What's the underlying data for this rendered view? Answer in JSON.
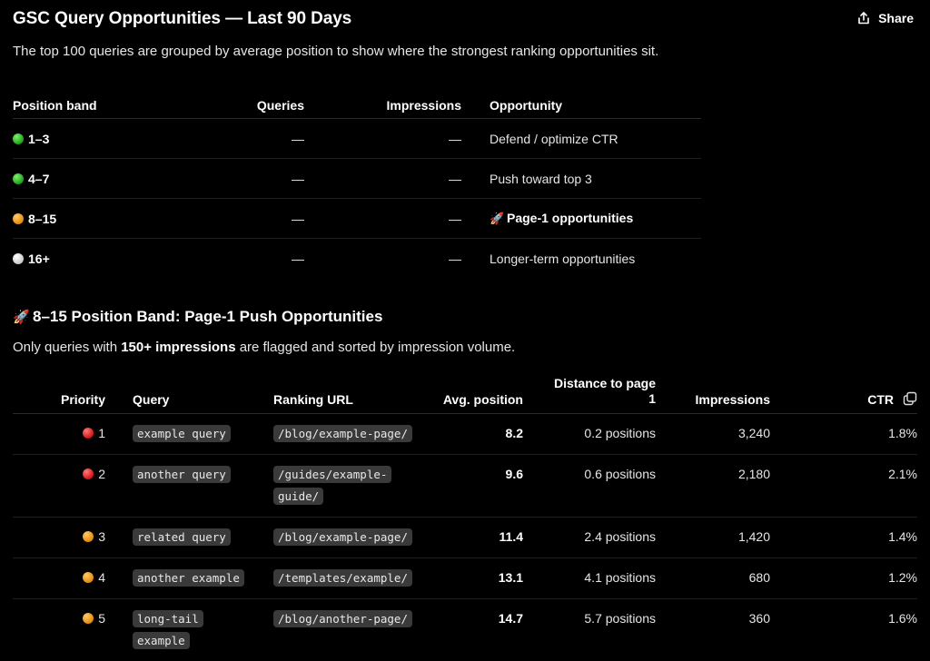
{
  "header": {
    "title": "GSC Query Opportunities — Last 90 Days",
    "share_label": "Share"
  },
  "intro": "The top 100 queries are grouped by average position to show where the strongest ranking opportunities sit.",
  "bands_table": {
    "headers": [
      "Position band",
      "Queries",
      "Impressions",
      "Opportunity"
    ],
    "rows": [
      {
        "band": "1–3",
        "dot": "green",
        "queries": "—",
        "impressions": "—",
        "opportunity": "Defend / optimize CTR",
        "rocket": false
      },
      {
        "band": "4–7",
        "dot": "green",
        "queries": "—",
        "impressions": "—",
        "opportunity": "Push toward top 3",
        "rocket": false
      },
      {
        "band": "8–15",
        "dot": "orange",
        "queries": "—",
        "impressions": "—",
        "opportunity": "Page-1 opportunities",
        "rocket": true
      },
      {
        "band": "16+",
        "dot": "white",
        "queries": "—",
        "impressions": "—",
        "opportunity": "Longer-term opportunities",
        "rocket": false
      }
    ]
  },
  "section": {
    "heading": "8–15 Position Band: Page-1 Push Opportunities",
    "rocket_icon": "🚀",
    "note_before": "Only queries with ",
    "note_bold": "150+ impressions",
    "note_after": " are flagged and sorted by impression volume."
  },
  "opportunities_table": {
    "headers": [
      "Priority",
      "Query",
      "Ranking URL",
      "Avg. position",
      "Distance to page 1",
      "Impressions",
      "CTR"
    ],
    "rows": [
      {
        "priority": "1",
        "dot": "red",
        "query": "example query",
        "url": "/blog/example-page/",
        "avg": "8.2",
        "distance": "0.2 positions",
        "impressions": "3,240",
        "ctr": "1.8%"
      },
      {
        "priority": "2",
        "dot": "red",
        "query": "another query",
        "url": "/guides/example-guide/",
        "avg": "9.6",
        "distance": "0.6 positions",
        "impressions": "2,180",
        "ctr": "2.1%"
      },
      {
        "priority": "3",
        "dot": "orange",
        "query": "related query",
        "url": "/blog/example-page/",
        "avg": "11.4",
        "distance": "2.4 positions",
        "impressions": "1,420",
        "ctr": "1.4%"
      },
      {
        "priority": "4",
        "dot": "orange",
        "query": "another example",
        "url": "/templates/example/",
        "avg": "13.1",
        "distance": "4.1 positions",
        "impressions": "680",
        "ctr": "1.2%"
      },
      {
        "priority": "5",
        "dot": "orange",
        "query": "long-tail example",
        "url": "/blog/another-page/",
        "avg": "14.7",
        "distance": "5.7 positions",
        "impressions": "360",
        "ctr": "1.6%"
      }
    ]
  },
  "icons": {
    "share": "share-icon",
    "copy": "copy-icon",
    "status_dots": {
      "green": "#1ea21b",
      "orange": "#e58a0c",
      "white": "#d9d9d9",
      "red": "#d0141a"
    }
  }
}
